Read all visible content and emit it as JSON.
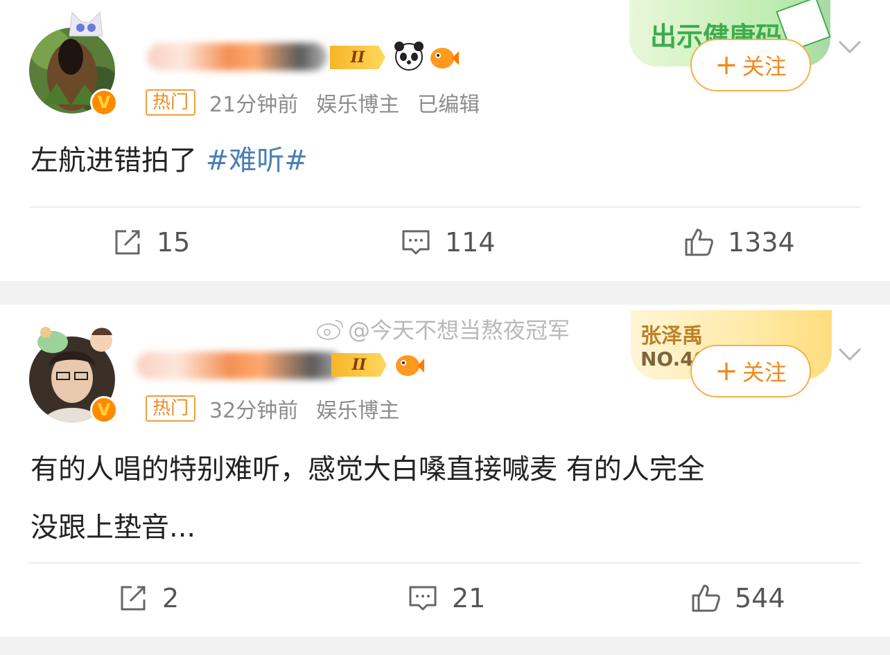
{
  "posts": [
    {
      "hot_tag": "热门",
      "time": "21分钟前",
      "role": "娱乐博主",
      "edited": "已编辑",
      "follow_label": "关注",
      "level": "II",
      "promo_text": "出示健康码",
      "text": "左航进错拍了 ",
      "topic": "#难听#",
      "reposts": "15",
      "comments": "114",
      "likes": "1334"
    },
    {
      "hot_tag": "热门",
      "time": "32分钟前",
      "role": "娱乐博主",
      "follow_label": "关注",
      "level": "II",
      "promo_name": "张泽禹",
      "promo_rank": "NO.40",
      "watermark": "@今天不想当熬夜冠军",
      "text_line1": "有的人唱的特别难听，感觉大白嗓直接喊麦 有的人完全",
      "text_line2": "没跟上垫音...",
      "reposts": "2",
      "comments": "21",
      "likes": "544"
    }
  ],
  "colors": {
    "accent": "#f08a1e",
    "topic": "#4b7fb4",
    "meta": "#8c8c8c",
    "page_bg": "#f2f2f2"
  },
  "icons": [
    "verified-icon",
    "panda-icon",
    "fish-icon",
    "chevron-down-icon",
    "repost-icon",
    "comment-icon",
    "like-icon",
    "weibo-logo-icon"
  ]
}
